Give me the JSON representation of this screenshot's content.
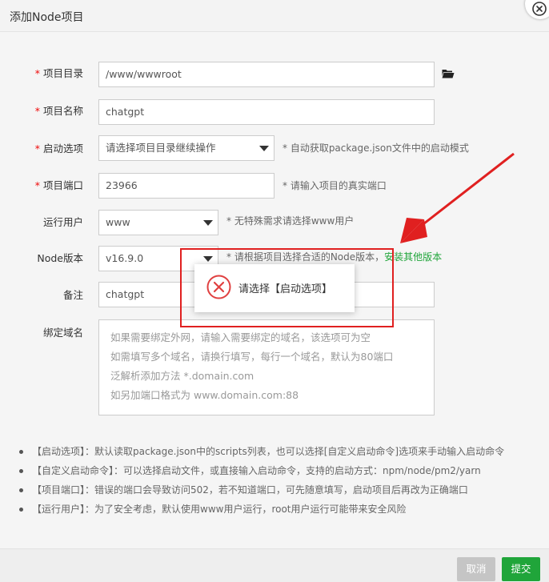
{
  "dialog": {
    "title": "添加Node项目"
  },
  "form": {
    "required_mark": "*",
    "project_dir": {
      "label": "项目目录",
      "value": "/www/wwwroot"
    },
    "project_name": {
      "label": "项目名称",
      "value": "chatgpt"
    },
    "start_option": {
      "label": "启动选项",
      "value": "请选择项目目录继续操作",
      "hint": "* 自动获取package.json文件中的启动模式"
    },
    "project_port": {
      "label": "项目端口",
      "value": "23966",
      "hint": "* 请输入项目的真实端口"
    },
    "run_user": {
      "label": "运行用户",
      "value": "www",
      "hint": "* 无特殊需求请选择www用户"
    },
    "node_version": {
      "label": "Node版本",
      "value": "v16.9.0",
      "hint": "* 请根据项目选择合适的Node版本，",
      "hint_link": "安装其他版本"
    },
    "remark": {
      "label": "备注",
      "value": "chatgpt"
    },
    "bind_domain": {
      "label": "绑定域名",
      "placeholder_lines": [
        "如果需要绑定外网，请输入需要绑定的域名，该选项可为空",
        "如需填写多个域名，请换行填写，每行一个域名，默认为80端口",
        "泛解析添加方法 *.domain.com",
        "如另加端口格式为 www.domain.com:88"
      ]
    }
  },
  "notes": [
    "【启动选项】：默认读取package.json中的scripts列表，也可以选择[自定义启动命令]选项来手动输入启动命令",
    "【自定义启动命令】：可以选择启动文件，或直接输入启动命令，支持的启动方式：npm/node/pm2/yarn",
    "【项目端口】：错误的端口会导致访问502，若不知道端口，可先随意填写，启动项目后再改为正确端口",
    "【运行用户】：为了安全考虑，默认使用www用户运行，root用户运行可能带来安全风险"
  ],
  "footer": {
    "cancel_label": "取消",
    "submit_label": "提交"
  },
  "toast": {
    "message": "请选择【启动选项】"
  },
  "colors": {
    "accent_green": "#20a53a",
    "error_red": "#e02020",
    "required_star": "#ef0808"
  },
  "icons": {
    "folder": "folder-open-icon",
    "close": "close-icon",
    "error": "error-circle-icon",
    "dropdown": "chevron-down-icon"
  }
}
